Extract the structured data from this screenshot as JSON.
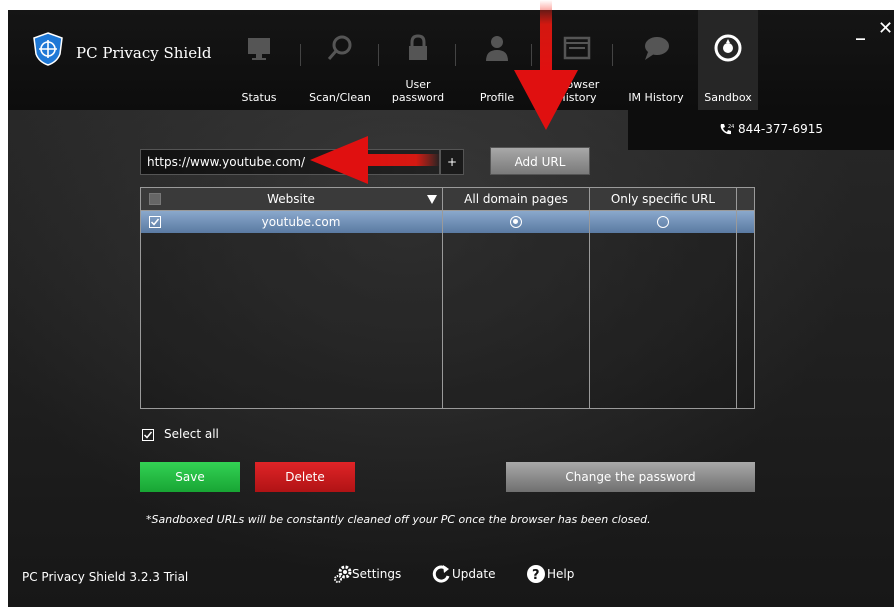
{
  "app": {
    "title": "PC Privacy Shield",
    "version": "PC Privacy Shield 3.2.3 Trial",
    "phone": "844-377-6915"
  },
  "tabs": [
    {
      "label": "Status",
      "icon": "monitor-icon"
    },
    {
      "label": "Scan/Clean",
      "icon": "magnifier-icon"
    },
    {
      "label": "User\npassword",
      "icon": "lock-icon"
    },
    {
      "label": "Profile",
      "icon": "person-icon"
    },
    {
      "label": "Browser\nHistory",
      "icon": "browser-window-icon"
    },
    {
      "label": "IM History",
      "icon": "chat-bubble-icon"
    },
    {
      "label": "Sandbox",
      "icon": "sandbox-icon",
      "active": true
    }
  ],
  "url_entry": {
    "value": "https://www.youtube.com/",
    "plus_label": "+",
    "add_button": "Add URL"
  },
  "table": {
    "headers": [
      "Website",
      "All domain pages",
      "Only specific URL"
    ],
    "rows": [
      {
        "website": "youtube.com",
        "checked": true,
        "mode": "All domain pages"
      }
    ]
  },
  "select_all": {
    "label": "Select all",
    "checked": true
  },
  "buttons": {
    "save": "Save",
    "delete": "Delete",
    "change_password": "Change the password"
  },
  "footnote": "*Sandboxed URLs will be constantly cleaned off your PC once the browser has been closed.",
  "footer": {
    "settings": "Settings",
    "update": "Update",
    "help": "Help"
  },
  "colors": {
    "accent_blue": "#1e78d6",
    "save_green": "#22b53e",
    "delete_red": "#cf1c1f",
    "annotation_red": "#e01010"
  }
}
